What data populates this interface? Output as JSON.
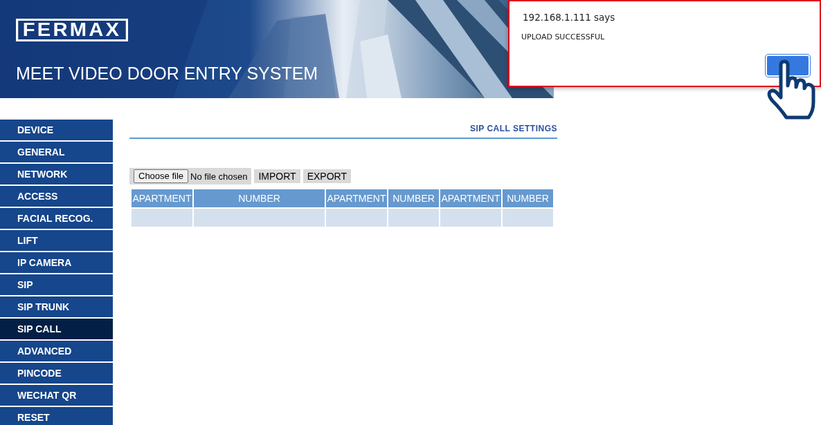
{
  "header": {
    "logo": "FERMAX",
    "title": "MEET VIDEO DOOR ENTRY SYSTEM"
  },
  "sidebar": {
    "items": [
      {
        "label": "DEVICE",
        "selected": false
      },
      {
        "label": "GENERAL",
        "selected": false
      },
      {
        "label": "NETWORK",
        "selected": false
      },
      {
        "label": "ACCESS",
        "selected": false
      },
      {
        "label": "FACIAL RECOG.",
        "selected": false
      },
      {
        "label": "LIFT",
        "selected": false
      },
      {
        "label": "IP CAMERA",
        "selected": false
      },
      {
        "label": "SIP",
        "selected": false
      },
      {
        "label": "SIP TRUNK",
        "selected": false
      },
      {
        "label": "SIP CALL",
        "selected": true
      },
      {
        "label": "ADVANCED",
        "selected": false
      },
      {
        "label": "PINCODE",
        "selected": false
      },
      {
        "label": "WECHAT QR",
        "selected": false
      },
      {
        "label": "RESET",
        "selected": false
      }
    ]
  },
  "content": {
    "title": "SIP CALL SETTINGS",
    "file_button": "Choose file",
    "file_status": "No file chosen",
    "buttons": [
      "IMPORT",
      "EXPORT"
    ],
    "table": {
      "columns": [
        "APARTMENT",
        "NUMBER",
        "APARTMENT",
        "NUMBER",
        "APARTMENT",
        "NUMBER"
      ]
    }
  },
  "dialog": {
    "origin": "192.168.1.111 says",
    "message": "UPLOAD SUCCESSFUL"
  }
}
